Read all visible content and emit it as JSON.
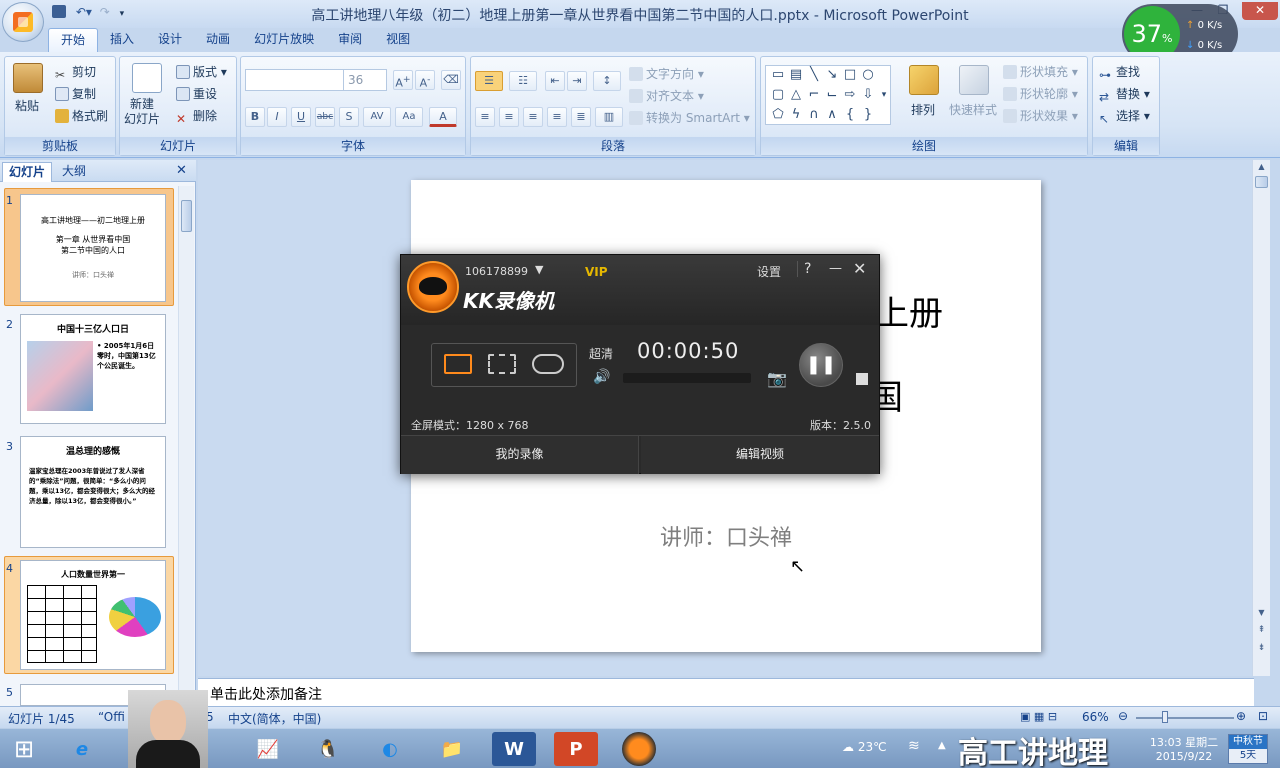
{
  "window": {
    "title": "高工讲地理八年级（初二）地理上册第一章从世界看中国第二节中国的人口.pptx - Microsoft PowerPoint",
    "controls": [
      "—",
      "❐",
      "✕"
    ]
  },
  "ribbon": {
    "tabs": [
      "开始",
      "插入",
      "设计",
      "动画",
      "幻灯片放映",
      "审阅",
      "视图"
    ],
    "clipboard": {
      "label": "剪贴板",
      "paste": "粘贴",
      "cut": "剪切",
      "copy": "复制",
      "format_painter": "格式刷"
    },
    "slides": {
      "label": "幻灯片",
      "new_slide": "新建\n幻灯片",
      "layout": "版式",
      "reset": "重设",
      "delete": "删除"
    },
    "font": {
      "label": "字体",
      "font_name": "",
      "font_size": "36",
      "bold": "B",
      "italic": "I",
      "underline": "U",
      "strike": "abc",
      "shadow": "S",
      "spacing": "AV",
      "case": "Aa",
      "color": "A"
    },
    "paragraph": {
      "label": "段落",
      "text_direction": "文字方向",
      "align_text": "对齐文本",
      "convert_smartart": "转换为 SmartArt"
    },
    "drawing": {
      "label": "绘图",
      "arrange": "排列",
      "quick_styles": "快速样式",
      "shape_fill": "形状填充",
      "shape_outline": "形状轮廓",
      "shape_effects": "形状效果"
    },
    "editing": {
      "label": "编辑",
      "find": "查找",
      "replace": "替换",
      "select": "选择"
    }
  },
  "net_widget": {
    "percent": "37",
    "percent_sign": "%",
    "up": "0 K/s",
    "down": "0 K/s"
  },
  "pane": {
    "tabs": [
      "幻灯片",
      "大纲"
    ],
    "close": "✕",
    "thumbnails": [
      {
        "num": "1",
        "lines": [
          "高工讲地理——初二地理上册",
          "第一章 从世界看中国",
          "第二节中国的人口",
          "讲师：口头禅"
        ]
      },
      {
        "num": "2",
        "title": "中国十三亿人口日",
        "text": "• 2005年1月6日零时，中国第13亿个公民诞生。"
      },
      {
        "num": "3",
        "title": "温总理的感慨",
        "text": "温家宝总理在2003年曾说过了发人深省的“乘除法”问题，很简单：“多么小的问题，乘以13亿，都会变得很大；多么大的经济总量，除以13亿，都会变得很小。”"
      },
      {
        "num": "4",
        "title": "人口数量世界第一"
      },
      {
        "num": "5"
      }
    ]
  },
  "slide": {
    "title_visible": "理上册",
    "subtitle_visible": "国",
    "lecturer": "讲师：口头禅"
  },
  "notes_placeholder": "单击此处添加备注",
  "statusbar": {
    "slide_count": "幻灯片 1/45",
    "theme": "“Offi",
    "theme_tail": "5",
    "language": "中文(简体，中国)",
    "zoom": "66%"
  },
  "kk": {
    "user_id": "106178899",
    "vip": "VIP",
    "brand": "KK录像机",
    "settings": "设置",
    "help": "?",
    "minimize": "—",
    "close": "✕",
    "quality": "超清",
    "timer": "00:00:50",
    "mode": "全屏模式：1280 x 768",
    "version": "版本：2.5.0",
    "my_recordings": "我的录像",
    "edit_video": "编辑视频"
  },
  "taskbar": {
    "weather": "23℃",
    "overlay_text": "高工讲地理",
    "time": "13:03 星期二",
    "date": "2015/9/22",
    "festival": "中秋节",
    "days": "5天"
  },
  "colors": {
    "accent_orange": "#ff8a1c",
    "kk_bg": "#2a2a2a",
    "ribbon_text": "#15428b"
  }
}
